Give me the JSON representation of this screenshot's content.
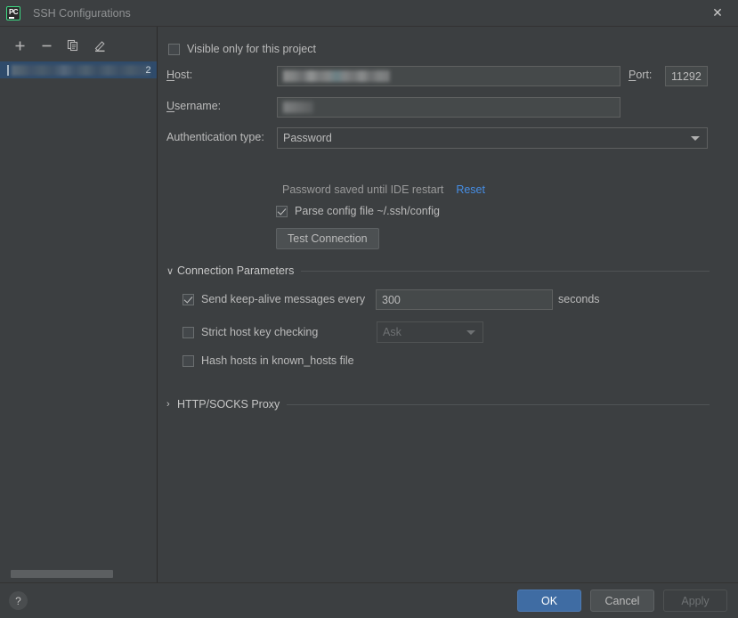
{
  "window": {
    "title": "SSH Configurations",
    "app_icon": "PC",
    "close_icon": "close-icon"
  },
  "sidebar": {
    "toolbar": [
      {
        "name": "add-button",
        "glyph": "+"
      },
      {
        "name": "remove-button",
        "glyph": "−"
      },
      {
        "name": "copy-button",
        "glyph": "❐"
      },
      {
        "name": "edit-button",
        "glyph": "✎"
      }
    ],
    "items": [
      {
        "label_visible_tail": "2",
        "redacted": true
      }
    ]
  },
  "form": {
    "visible_only_label": "Visible only for this project",
    "visible_only_checked": false,
    "host_label": "Host:",
    "host_value": "",
    "port_label": "Port:",
    "port_value": "11292",
    "username_label": "Username:",
    "username_value": "",
    "auth_type_label": "Authentication type:",
    "auth_type_value": "Password",
    "password_hint": "Password saved until IDE restart",
    "reset_link": "Reset",
    "parse_config_label": "Parse config file ~/.ssh/config",
    "parse_config_checked": true,
    "test_connection_label": "Test Connection"
  },
  "connection_parameters": {
    "title": "Connection Parameters",
    "expanded": true,
    "chevron": "∨",
    "keepalive_label": "Send keep-alive messages every",
    "keepalive_checked": true,
    "keepalive_value": "300",
    "keepalive_units": "seconds",
    "strict_host_label": "Strict host key checking",
    "strict_host_checked": false,
    "strict_host_value": "Ask",
    "hash_hosts_label": "Hash hosts in known_hosts file",
    "hash_hosts_checked": false
  },
  "proxy_section": {
    "title": "HTTP/SOCKS Proxy",
    "expanded": false,
    "chevron": "›"
  },
  "footer": {
    "help_glyph": "?",
    "ok_label": "OK",
    "cancel_label": "Cancel",
    "apply_label": "Apply"
  },
  "colors": {
    "window_bg": "#3c3f41",
    "field_bg": "#45494a",
    "accent_primary": "#3f6ca3",
    "link": "#468ee5",
    "selection": "#2f4b6b",
    "app_icon_border": "#3ddc84"
  }
}
